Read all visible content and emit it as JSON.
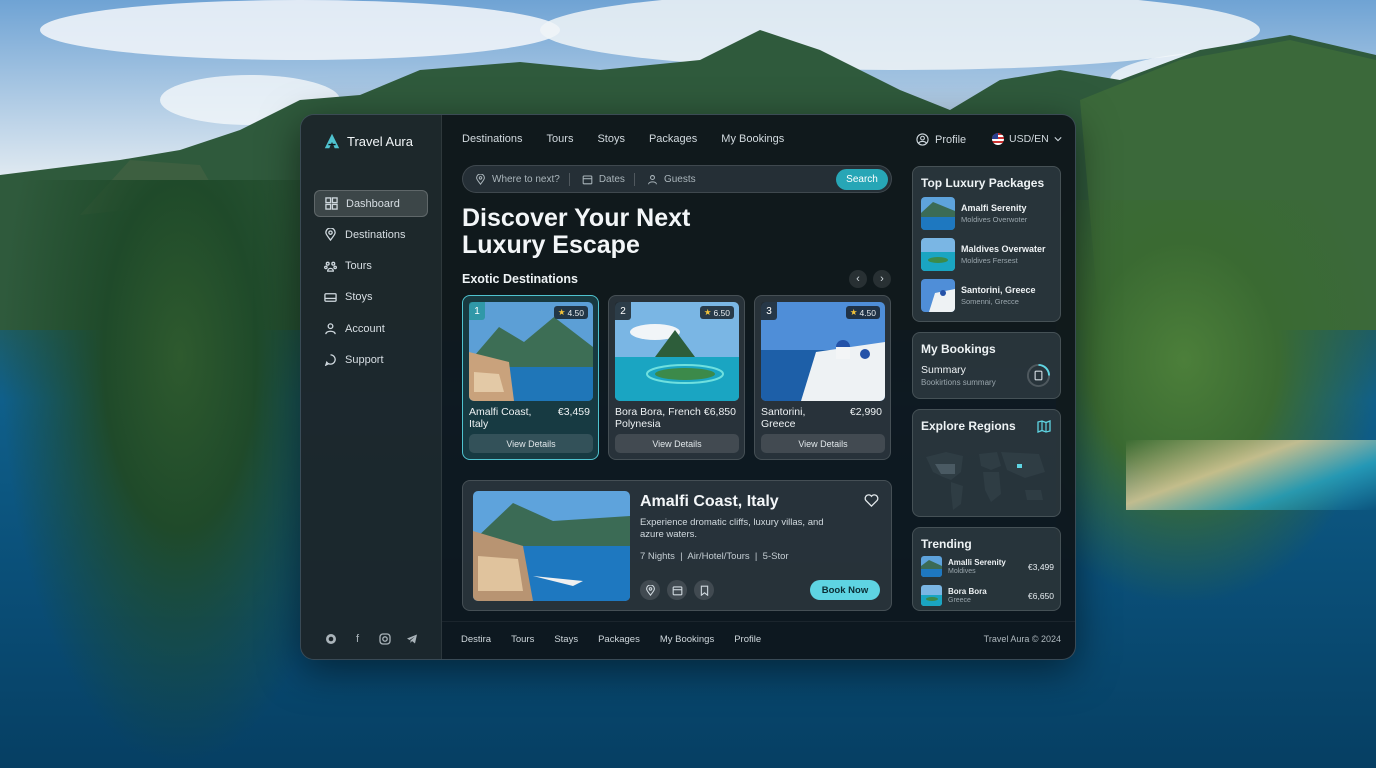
{
  "app": {
    "title": "Travel Aura"
  },
  "sidebar": {
    "items": [
      {
        "label": "Dashboard",
        "icon": "grid-icon",
        "active": true
      },
      {
        "label": "Destinations",
        "icon": "map-pin-icon"
      },
      {
        "label": "Tours",
        "icon": "paw-icon"
      },
      {
        "label": "Stoys",
        "icon": "bed-icon"
      },
      {
        "label": "Account",
        "icon": "user-icon"
      },
      {
        "label": "Support",
        "icon": "chat-icon"
      }
    ],
    "social": [
      "github-icon",
      "facebook-icon",
      "instagram-icon",
      "telegram-icon"
    ]
  },
  "topnav": {
    "links": [
      "Destinations",
      "Tours",
      "Stoys",
      "Packages",
      "My Bookings"
    ],
    "profile": "Profile",
    "currency": "USD/EN"
  },
  "search": {
    "where": "Where to next?",
    "dates": "Dates",
    "guests": "Guests",
    "button": "Search"
  },
  "hero": {
    "line1": "Discover Your Next",
    "line2": "Luxury Escape"
  },
  "destinations": {
    "title": "Exotic Destinations",
    "view_label": "View Details",
    "items": [
      {
        "num": "1",
        "rating": "4.50",
        "name": "Amalfi Coast, Italy",
        "price": "€3,459"
      },
      {
        "num": "2",
        "rating": "6.50",
        "name": "Bora Bora, French Polynesia",
        "price": "€6,850"
      },
      {
        "num": "3",
        "rating": "4.50",
        "name": "Santorini, Greece",
        "price": "€2,990"
      }
    ]
  },
  "featured": {
    "title": "Amalfi Coast, Italy",
    "description": "Experience dromatic cliffs, luxury villas, and azure waters.",
    "meta": "7 Nights  |  Air/Hotel/Tours  |  5-Stor",
    "book": "Book Now"
  },
  "top_packages": {
    "title": "Top Luxury Packages",
    "items": [
      {
        "name": "Amalfi Serenity",
        "sub": "Moldives Overwoter"
      },
      {
        "name": "Maldives Overwater",
        "sub": "Moldives Fersest"
      },
      {
        "name": "Santorini, Greece",
        "sub": "Somenni, Grecce"
      }
    ]
  },
  "bookings": {
    "title": "My Bookings",
    "summary": "Summary",
    "sub": "Bookirtions summary"
  },
  "regions": {
    "title": "Explore Regions"
  },
  "trending": {
    "title": "Trending",
    "items": [
      {
        "name": "Amalli Serenity",
        "sub": "Moldives",
        "price": "€3,499"
      },
      {
        "name": "Bora Bora",
        "sub": "Greece",
        "price": "€6,650"
      }
    ]
  },
  "footer": {
    "links": [
      "Destira",
      "Tours",
      "Stays",
      "Packages",
      "My Bookings",
      "Profile"
    ],
    "copyright": "Travel Aura © 2024"
  },
  "colors": {
    "accent": "#27a6b6",
    "book_button": "#5ed4e2",
    "panel": "#0e141a"
  }
}
